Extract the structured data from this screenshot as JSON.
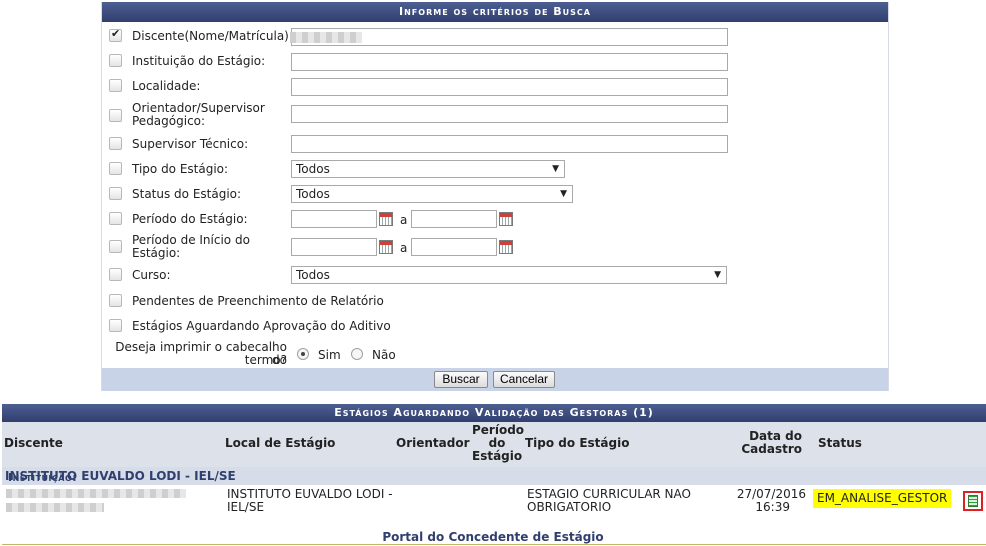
{
  "search": {
    "title": "Informe os critérios de Busca",
    "fields": {
      "discente": "Discente(Nome/Matrícula):",
      "instituicao": "Instituição do Estágio:",
      "localidade": "Localidade:",
      "orientador_1": "Orientador/Supervisor",
      "orientador_2": "Pedagógico:",
      "supervisor": "Supervisor Técnico:",
      "tipo": "Tipo do Estágio:",
      "status": "Status do Estágio:",
      "periodo": "Período do Estágio:",
      "periodo_inicio_1": "Período de Início do",
      "periodo_inicio_2": "Estágio:",
      "curso": "Curso:",
      "pendentes": "Pendentes de Preenchimento de Relatório",
      "aguardando": "Estágios Aguardando Aprovação do Aditivo"
    },
    "selects": {
      "tipo_value": "Todos",
      "status_value": "Todos",
      "curso_value": "Todos"
    },
    "date_separator": "a",
    "print_question_1": "Deseja imprimir o cabecalho do",
    "print_question_2": "termo?",
    "radio_sim": "Sim",
    "radio_nao": "Não",
    "buscar_label": "Buscar",
    "cancelar_label": "Cancelar"
  },
  "results": {
    "title": "Estágios Aguardando Validação das Gestoras (1)",
    "columns": {
      "discente": "Discente",
      "local": "Local de Estágio",
      "orientador": "Orientador",
      "periodo_1": "Período",
      "periodo_2": "do",
      "periodo_3": "Estágio",
      "tipo": "Tipo do Estágio",
      "data_1": "Data do",
      "data_2": "Cadastro",
      "status": "Status"
    },
    "group_prefix": "Instituição:",
    "group_name": "INSTITUTO EUVALDO LODI - IEL/SE",
    "rows": [
      {
        "local_1": "INSTITUTO EUVALDO LODI -",
        "local_2": "IEL/SE",
        "tipo_1": "ESTAGIO CURRICULAR NAO",
        "tipo_2": "OBRIGATORIO",
        "date": "27/07/2016",
        "time": "16:39",
        "status": "EM_ANALISE_GESTOR"
      }
    ]
  },
  "footer": {
    "portal": "Portal do Concedente de Estágio"
  },
  "colors": {
    "header": "#3b4a7d",
    "badge": "#ffff00",
    "highlight_border": "#e02020"
  }
}
